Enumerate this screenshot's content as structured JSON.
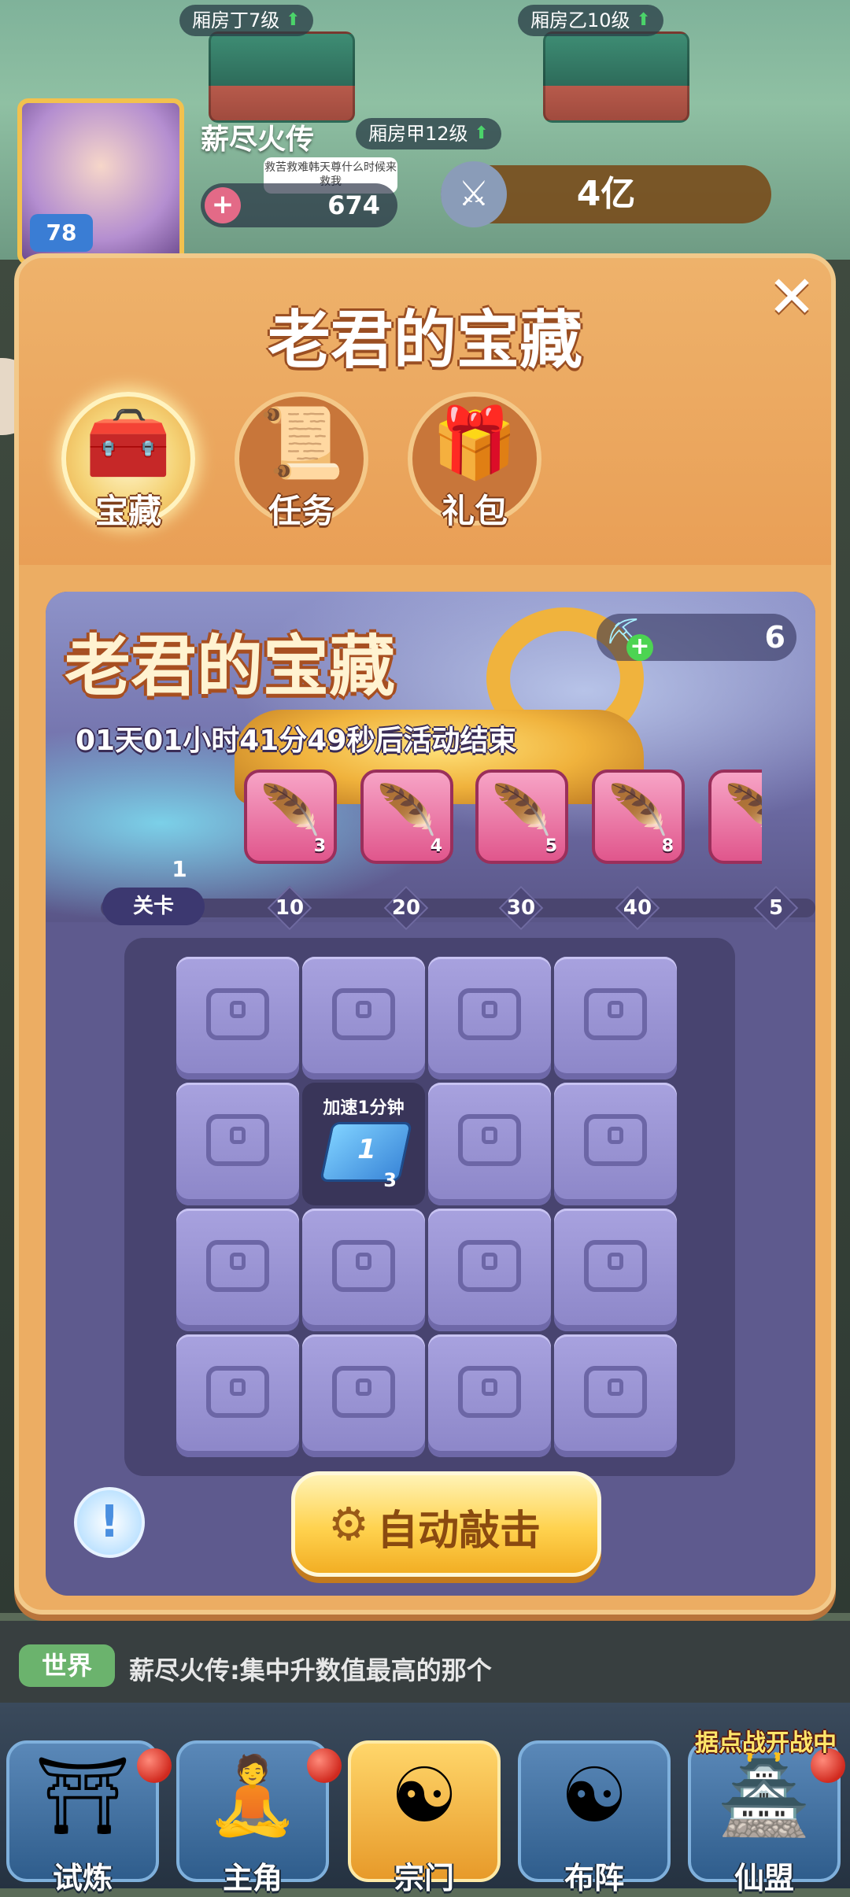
{
  "background": {
    "room_tags": [
      {
        "label": "厢房丁7级"
      },
      {
        "label": "厢房乙10级"
      },
      {
        "label": "厢房甲12级"
      }
    ],
    "player": {
      "name": "薪尽火传",
      "level": "78",
      "stat_value": "674",
      "power_value": "4亿",
      "speech_bubble": "救苦救难韩天尊什么时候来救我"
    }
  },
  "modal": {
    "title": "老君的宝藏",
    "close_icon": "close-icon",
    "tabs": [
      {
        "label": "宝藏",
        "icon": "treasure-chest-icon",
        "active": true
      },
      {
        "label": "任务",
        "icon": "scroll-icon",
        "active": false
      },
      {
        "label": "礼包",
        "icon": "gift-box-icon",
        "active": false
      }
    ],
    "banner": {
      "title": "老君的宝藏",
      "countdown": "01天01小时41分49秒后活动结束",
      "pickaxe_count": "6"
    },
    "rewards": [
      {
        "icon": "rainbow-feather-icon",
        "count": "3"
      },
      {
        "icon": "rainbow-feather-icon",
        "count": "4"
      },
      {
        "icon": "rainbow-feather-icon",
        "count": "5"
      },
      {
        "icon": "rainbow-feather-icon",
        "count": "8"
      },
      {
        "icon": "rainbow-feather-icon",
        "count": ""
      }
    ],
    "progress": {
      "current_stage": "1",
      "stage_label": "关卡",
      "markers": [
        "10",
        "20",
        "30",
        "40",
        "5"
      ]
    },
    "grid": {
      "rows": 4,
      "cols": 4,
      "open_cell": {
        "row": 1,
        "col": 1,
        "label": "加速1分钟",
        "count": "3",
        "icon": "speedup-ticket-icon",
        "ticket_text": "1"
      }
    },
    "info_button_icon": "info-icon",
    "auto_button": {
      "label": "自动敲击",
      "icon": "gear-icon"
    }
  },
  "chat": {
    "channel": "世界",
    "message": "薪尽火传:集中升数值最高的那个"
  },
  "bottom_nav": {
    "items": [
      {
        "label": "试炼",
        "icon": "shrine-icon",
        "active": false,
        "badge": true
      },
      {
        "label": "主角",
        "icon": "meditating-figure-icon",
        "active": false,
        "badge": true
      },
      {
        "label": "宗门",
        "icon": "incense-burner-icon",
        "active": true,
        "badge": false
      },
      {
        "label": "布阵",
        "icon": "yin-yang-formation-icon",
        "active": false,
        "badge": false
      },
      {
        "label": "仙盟",
        "icon": "alliance-gate-icon",
        "active": false,
        "badge": true
      }
    ],
    "event_banner": "据点战开战中"
  },
  "colors": {
    "modal_orange": "#ecad63",
    "panel_purple": "#5e5a8e",
    "button_gold": "#ffd24e",
    "cell_lavender": "#a8a2df"
  }
}
